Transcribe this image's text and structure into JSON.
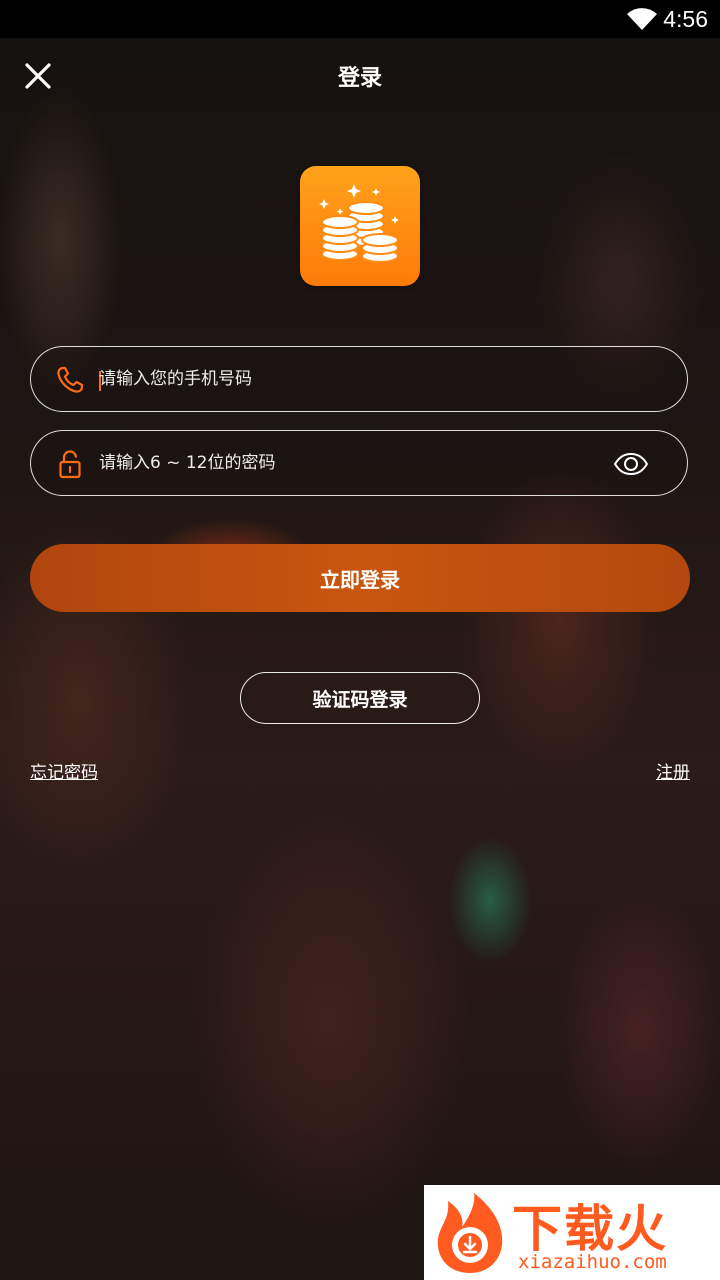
{
  "status_bar": {
    "time": "4:56",
    "wifi_icon": "wifi-icon"
  },
  "header": {
    "title": "登录",
    "close_icon": "close-icon"
  },
  "logo": {
    "icon": "coins-icon"
  },
  "form": {
    "phone_placeholder": "请输入您的手机号码",
    "phone_value": "",
    "phone_icon": "phone-icon",
    "password_placeholder": "请输入6 ~ 12位的密码",
    "password_value": "",
    "password_icon": "lock-icon",
    "toggle_visibility_icon": "eye-icon"
  },
  "actions": {
    "login_label": "立即登录",
    "code_login_label": "验证码登录",
    "forgot_label": "忘记密码",
    "register_label": "注册"
  },
  "watermark": {
    "title": "下载火",
    "subtitle": "xiazaihuo.com"
  },
  "colors": {
    "accent": "#ff6a13",
    "login_button": "#c0500f",
    "logo_bg": "#ff8c10"
  }
}
